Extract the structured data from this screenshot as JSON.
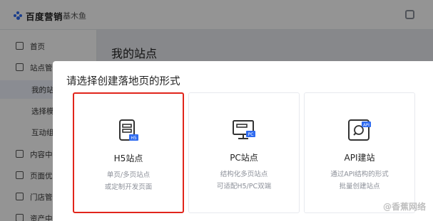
{
  "header": {
    "brand": "百度营销",
    "product": "基木鱼"
  },
  "sidebar": {
    "items": [
      {
        "label": "首页",
        "icon": "home-icon"
      },
      {
        "label": "站点管理",
        "icon": "grid-icon"
      }
    ],
    "sub_items": [
      {
        "label": "我的站点"
      },
      {
        "label": "选择模板"
      },
      {
        "label": "互动组件"
      }
    ],
    "items_lower": [
      {
        "label": "内容中心",
        "icon": "content-icon"
      },
      {
        "label": "页面优化",
        "icon": "optimize-icon"
      },
      {
        "label": "门店管理",
        "icon": "store-icon"
      },
      {
        "label": "资产中心",
        "icon": "asset-icon"
      }
    ]
  },
  "main": {
    "title": "我的站点"
  },
  "modal": {
    "title": "请选择创建落地页的形式",
    "options": [
      {
        "name": "H5站点",
        "desc_line1": "单页/多页站点",
        "desc_line2": "或定制开发页面",
        "icon": "h5-site-icon",
        "selected": true
      },
      {
        "name": "PC站点",
        "desc_line1": "结构化多页站点",
        "desc_line2": "可适配H5/PC双端",
        "icon": "pc-site-icon",
        "selected": false
      },
      {
        "name": "API建站",
        "desc_line1": "通过API结构的形式",
        "desc_line2": "批量创建站点",
        "icon": "api-site-icon",
        "selected": false
      }
    ]
  },
  "watermark": "@香蕉网络",
  "colors": {
    "accent": "#2f6bf0",
    "selected_border": "#e1251b"
  }
}
